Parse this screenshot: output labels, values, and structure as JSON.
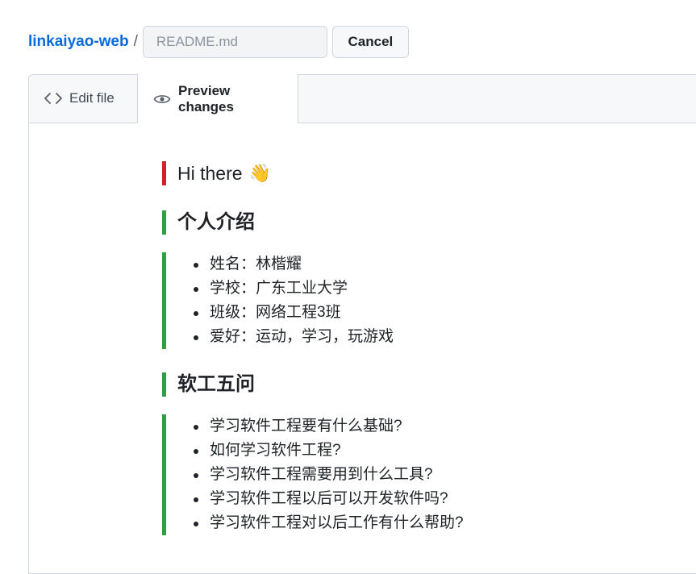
{
  "header": {
    "repo_name": "linkaiyao-web",
    "separator": "/",
    "filename_placeholder": "README.md",
    "cancel_label": "Cancel"
  },
  "tabs": [
    {
      "label": "Edit file",
      "icon": "code-icon"
    },
    {
      "label": "Preview changes",
      "icon": "eye-icon"
    }
  ],
  "preview": {
    "greeting": "Hi there",
    "greeting_emoji": "👋",
    "section1": {
      "heading": "个人介绍",
      "items": [
        "姓名：林楷耀",
        "学校：广东工业大学",
        "班级：网络工程3班",
        "爱好：运动，学习，玩游戏"
      ]
    },
    "section2": {
      "heading": "软工五问",
      "items": [
        "学习软件工程要有什么基础?",
        "如何学习软件工程?",
        "学习软件工程需要用到什么工具?",
        "学习软件工程以后可以开发软件吗?",
        "学习软件工程对以后工作有什么帮助?"
      ]
    }
  },
  "colors": {
    "link": "#0969da",
    "added_marker": "#2ea043",
    "changed_marker": "#cf222e"
  }
}
